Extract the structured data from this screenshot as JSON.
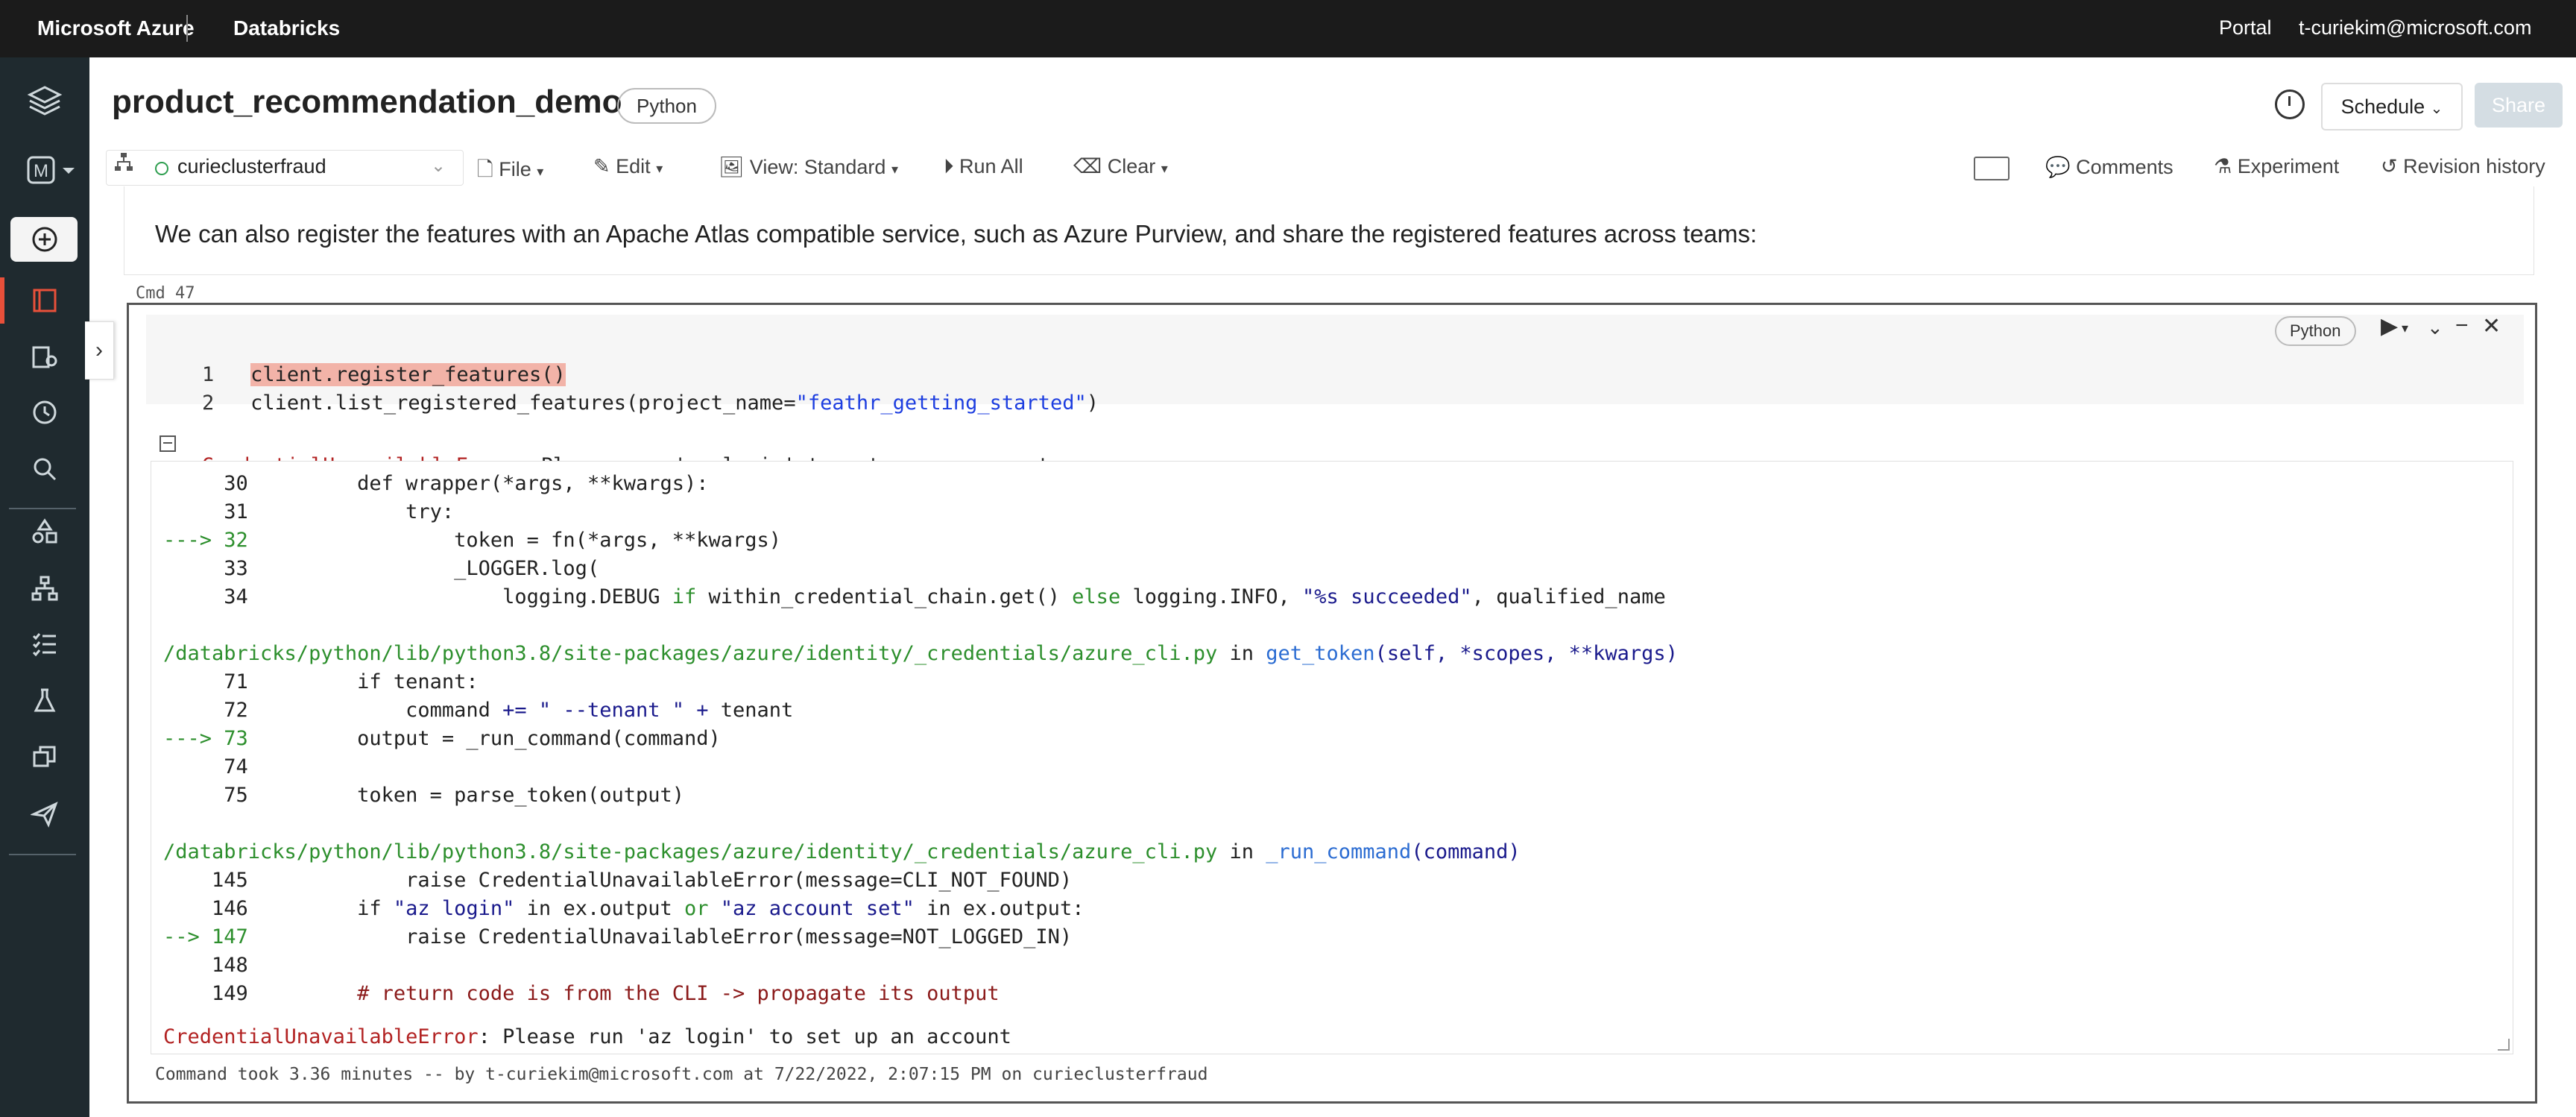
{
  "topbar": {
    "brand": "Microsoft Azure",
    "product": "Databricks",
    "portal": "Portal",
    "user": "t-curiekim@microsoft.com"
  },
  "sidebar": {
    "workspace_initial": "M",
    "icons": [
      "layers-icon",
      "workspace-switcher-icon",
      "create-icon",
      "notebook-icon",
      "data-icon",
      "clock-icon",
      "search-icon",
      "shapes-icon",
      "hierarchy-icon",
      "tasks-icon",
      "flask-icon",
      "copy-icon",
      "deploy-icon"
    ]
  },
  "header": {
    "title": "product_recommendation_demo",
    "language": "Python",
    "schedule_label": "Schedule",
    "share_label": "Share"
  },
  "toolbar": {
    "cluster": "curieclusterfraud",
    "file": "File",
    "edit": "Edit",
    "view": "View: Standard",
    "run_all": "Run All",
    "clear": "Clear",
    "comments": "Comments",
    "experiment": "Experiment",
    "revision_history": "Revision history"
  },
  "markdown_cell": {
    "text": "We can also register the features with an Apache Atlas compatible service, such as Azure Purview, and share the registered features across teams:"
  },
  "cell": {
    "cmd_label": "Cmd 47",
    "language": "Python",
    "code": {
      "l1_num": "1",
      "l1": "client.register_features()",
      "l2_num": "2",
      "l2_prefix": "client.list_registered_features(project_name=",
      "l2_str": "\"feathr_getting_started\"",
      "l2_suffix": ")"
    },
    "error_header_name": "CredentialUnavailableError",
    "error_header_msg": ": Please run 'az login' to set up an account",
    "traceback": {
      "a30": "     30         def wrapper(*args, **kwargs):",
      "a31": "     31             try:",
      "a32_arrow": "---> 32",
      "a32": "                 token = fn(*args, **kwargs)",
      "a33": "     33                 _LOGGER.log(",
      "a34_pre": "     34                     logging.DEBUG ",
      "a34_if": "if",
      "a34_mid": " within_credential_chain.get() ",
      "a34_else": "else",
      "a34_mid2": " logging.INFO, ",
      "a34_str": "\"%s succeeded\"",
      "a34_post": ", qualified_name",
      "path1": "/databricks/python/lib/python3.8/site-packages/azure/identity/_credentials/azure_cli.py",
      "path1_in": " in ",
      "path1_fn": "get_token",
      "path1_args": "(self, *scopes, **kwargs)",
      "b71": "     71         if tenant:",
      "b72_pre": "     72             command ",
      "b72_op": "+= \" --tenant \" +",
      "b72_post": " tenant",
      "b73_arrow": "---> 73",
      "b73": "         output = _run_command(command)",
      "b74": "     74",
      "b75": "     75         token = parse_token(output)",
      "path2": "/databricks/python/lib/python3.8/site-packages/azure/identity/_credentials/azure_cli.py",
      "path2_in": " in ",
      "path2_fn": "_run_command",
      "path2_args": "(command)",
      "c145": "    145             raise CredentialUnavailableError(message=CLI_NOT_FOUND)",
      "c146_pre": "    146         if ",
      "c146_s1": "\"az login\"",
      "c146_mid": " in ex.output ",
      "c146_or": "or",
      "c146_sp": " ",
      "c146_s2": "\"az account set\"",
      "c146_post": " in ex.output:",
      "c147_arrow": "--> 147",
      "c147": "             raise CredentialUnavailableError(message=NOT_LOGGED_IN)",
      "c148": "    148",
      "c149_num": "    149         ",
      "c149_comment": "# return code is from the CLI -> propagate its output",
      "final_name": "CredentialUnavailableError",
      "final_msg": ": Please run 'az login' to set up an account"
    },
    "footer": "Command took 3.36 minutes -- by t-curiekim@microsoft.com at 7/22/2022, 2:07:15 PM on curieclusterfraud"
  }
}
